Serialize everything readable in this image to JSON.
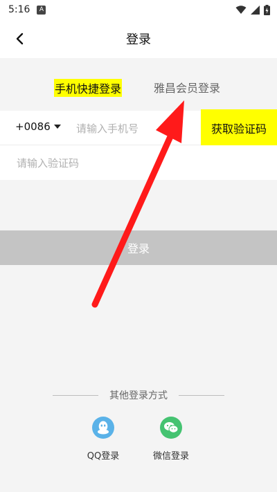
{
  "status_bar": {
    "time": "5:16"
  },
  "header": {
    "title": "登录"
  },
  "tabs": [
    {
      "label": "手机快捷登录",
      "active": true
    },
    {
      "label": "雅昌会员登录",
      "active": false
    }
  ],
  "phone": {
    "country_code": "+0086",
    "placeholder": "请输入手机号",
    "value": ""
  },
  "get_code_label": "获取验证码",
  "code": {
    "placeholder": "请输入验证码",
    "value": ""
  },
  "login_button_label": "登录",
  "other_login": {
    "title": "其他登录方式",
    "options": [
      {
        "label": "QQ登录",
        "icon": "qq-icon",
        "color": "#5ab2e8"
      },
      {
        "label": "微信登录",
        "icon": "wechat-icon",
        "color": "#45c371"
      }
    ]
  },
  "colors": {
    "highlight": "#ffff00",
    "login_button_disabled": "#c4c4c4",
    "annotation_arrow": "#ff1a1a"
  }
}
